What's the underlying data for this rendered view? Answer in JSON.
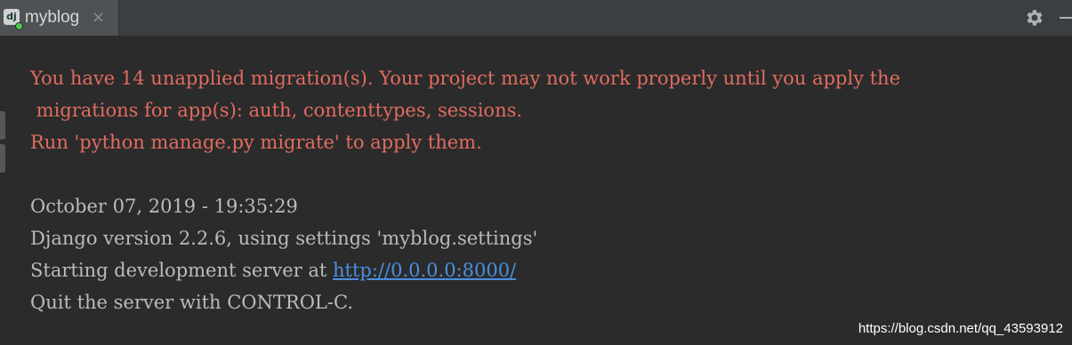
{
  "tab": {
    "icon_text": "dj",
    "label": "myblog",
    "close": "×"
  },
  "console": {
    "error_lines": [
      "You have 14 unapplied migration(s). Your project may not work properly until you apply the",
      " migrations for app(s): auth, contenttypes, sessions.",
      "Run 'python manage.py migrate' to apply them."
    ],
    "info_lines": [
      "October 07, 2019 - 19:35:29",
      "Django version 2.2.6, using settings 'myblog.settings'"
    ],
    "server_prefix": "Starting development server at ",
    "server_url": "http://0.0.0.0:8000/",
    "quit_line": "Quit the server with CONTROL-C."
  },
  "watermark": "https://blog.csdn.net/qq_43593912",
  "colors": {
    "background": "#2b2b2b",
    "error_text": "#e06c60",
    "normal_text": "#bbbbbb",
    "link": "#4a8fe0"
  },
  "icons": {
    "settings": "gear-icon",
    "hide": "minimize-icon",
    "close": "close-icon"
  }
}
